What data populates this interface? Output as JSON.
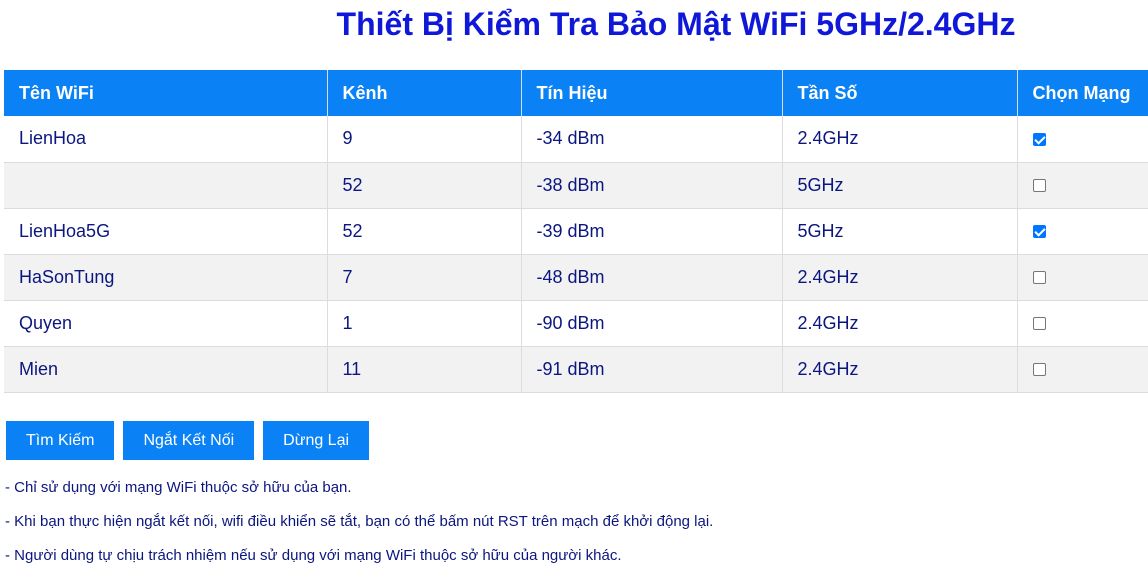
{
  "page": {
    "title": "Thiết Bị Kiểm Tra Bảo Mật WiFi 5GHz/2.4GHz"
  },
  "table": {
    "headers": [
      "Tên WiFi",
      "Kênh",
      "Tín Hiệu",
      "Tần Số",
      "Chọn Mạng"
    ],
    "rows": [
      {
        "name": "LienHoa",
        "channel": "9",
        "signal": "-34 dBm",
        "freq": "2.4GHz",
        "selected": true
      },
      {
        "name": "",
        "channel": "52",
        "signal": "-38 dBm",
        "freq": "5GHz",
        "selected": false
      },
      {
        "name": "LienHoa5G",
        "channel": "52",
        "signal": "-39 dBm",
        "freq": "5GHz",
        "selected": true
      },
      {
        "name": "HaSonTung",
        "channel": "7",
        "signal": "-48 dBm",
        "freq": "2.4GHz",
        "selected": false
      },
      {
        "name": "Quyen",
        "channel": "1",
        "signal": "-90 dBm",
        "freq": "2.4GHz",
        "selected": false
      },
      {
        "name": "Mien",
        "channel": "11",
        "signal": "-91 dBm",
        "freq": "2.4GHz",
        "selected": false
      }
    ]
  },
  "buttons": {
    "search": "Tìm Kiếm",
    "disconnect": "Ngắt Kết Nối",
    "stop": "Dừng Lại"
  },
  "notes": [
    "- Chỉ sử dụng với mạng WiFi thuộc sở hữu của bạn.",
    "- Khi bạn thực hiện ngắt kết nối, wifi điều khiển sẽ tắt, bạn có thể bấm nút RST trên mạch để khởi động lại.",
    "- Người dùng tự chịu trách nhiệm nếu sử dụng với mạng WiFi thuộc sở hữu của người khác."
  ],
  "colors": {
    "accent": "#0a82f5",
    "title": "#0f17d9",
    "text": "#0b1680"
  }
}
